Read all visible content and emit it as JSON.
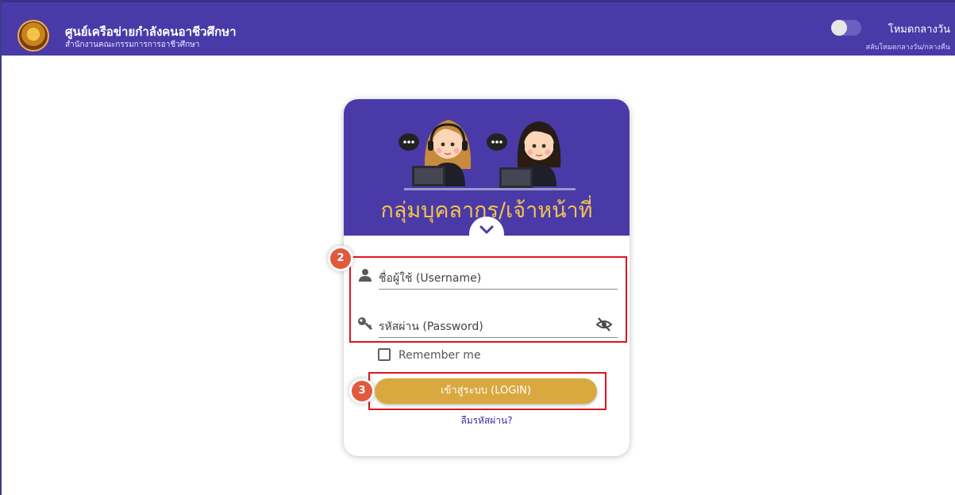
{
  "header": {
    "title": "ศูนย์เครือข่ายกำลังคนอาชีวศึกษา",
    "subtitle": "สำนักงานคณะกรรมการการอาชีวศึกษา",
    "logo_icon": "seal-logo"
  },
  "theme_toggle": {
    "label": "โหมดกลางวัน",
    "sublabel": "สลับโหมดกลางวัน/กลางคืน",
    "state": "off"
  },
  "login_card": {
    "banner_title": "กลุ่มบุคลากร/เจ้าหน้าที่",
    "banner_illustration": "two-call-center-agents",
    "chevron_icon": "chevron-down-icon",
    "username_placeholder": "ชื่อผู้ใช้ (Username)",
    "password_placeholder": "รหัสผ่าน (Password)",
    "remember_label": "Remember me",
    "login_label": "เข้าสู่ระบบ (LOGIN)",
    "forgot_label": "ลืมรหัสผ่าน?"
  },
  "annotations": {
    "marker_fields": "2",
    "marker_login": "3"
  },
  "colors": {
    "primary": "#4a3aa8",
    "accent": "#f3c44c",
    "button": "#d9a83f",
    "highlight": "#e0141e",
    "marker": "#e05a3e"
  }
}
